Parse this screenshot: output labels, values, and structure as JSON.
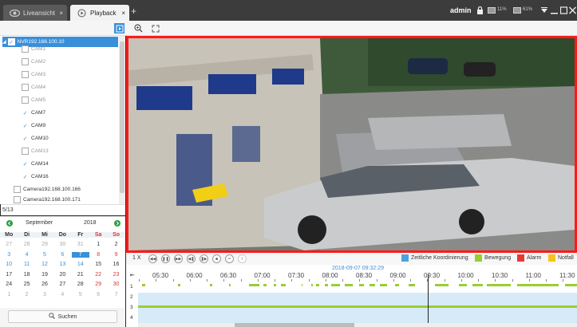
{
  "tabs": [
    {
      "label": "Liveansicht",
      "close": "×"
    },
    {
      "label": "Playback",
      "close": "×"
    }
  ],
  "new_tab": "+",
  "header": {
    "user": "admin",
    "cpu": "11%",
    "mem": "61%"
  },
  "tree": {
    "root": "NVR192.168.100.10",
    "cams": [
      {
        "label": "CAM1",
        "checked": false
      },
      {
        "label": "CAM2",
        "checked": false
      },
      {
        "label": "CAM3",
        "checked": false
      },
      {
        "label": "CAM4",
        "checked": false
      },
      {
        "label": "CAM5",
        "checked": false
      },
      {
        "label": "CAM7",
        "checked": true
      },
      {
        "label": "CAM9",
        "checked": true
      },
      {
        "label": "CAM10",
        "checked": true
      },
      {
        "label": "CAM13",
        "checked": false
      },
      {
        "label": "CAM14",
        "checked": true
      },
      {
        "label": "CAM16",
        "checked": true
      }
    ],
    "camera2": "Camera192.168.100.166",
    "camera3": "Camera192.168.100.171",
    "count": "5/13"
  },
  "calendar": {
    "month": "September",
    "year": "2018",
    "weekdays": [
      "Mo",
      "Di",
      "Mi",
      "Do",
      "Fr",
      "Sa",
      "So"
    ],
    "weeks": [
      [
        "27",
        "28",
        "29",
        "30",
        "31",
        "1",
        "2"
      ],
      [
        "3",
        "4",
        "5",
        "6",
        "7",
        "8",
        "9"
      ],
      [
        "10",
        "11",
        "12",
        "13",
        "14",
        "15",
        "16"
      ],
      [
        "17",
        "18",
        "19",
        "20",
        "21",
        "22",
        "23"
      ],
      [
        "24",
        "25",
        "26",
        "27",
        "28",
        "29",
        "30"
      ],
      [
        "1",
        "2",
        "3",
        "4",
        "5",
        "6",
        "7"
      ]
    ],
    "selected": "7",
    "search": "Suchen"
  },
  "controls": {
    "speed": "1 X"
  },
  "legend": [
    {
      "label": "Zeitliche Koordinierung",
      "color": "#4aa3df"
    },
    {
      "label": "Bewegung",
      "color": "#9acd32"
    },
    {
      "label": "Alarm",
      "color": "#e53935"
    },
    {
      "label": "Notfall",
      "color": "#f5c518"
    }
  ],
  "timeline": {
    "timestamp": "2018-09-07 09:32:29",
    "labels": [
      "05:30",
      "06:00",
      "06:30",
      "07:00",
      "07:30",
      "08:00",
      "08:30",
      "09:00",
      "09:30",
      "10:00",
      "10:30",
      "11:00",
      "11:30"
    ],
    "rows": [
      "1",
      "2",
      "3",
      "4"
    ]
  }
}
